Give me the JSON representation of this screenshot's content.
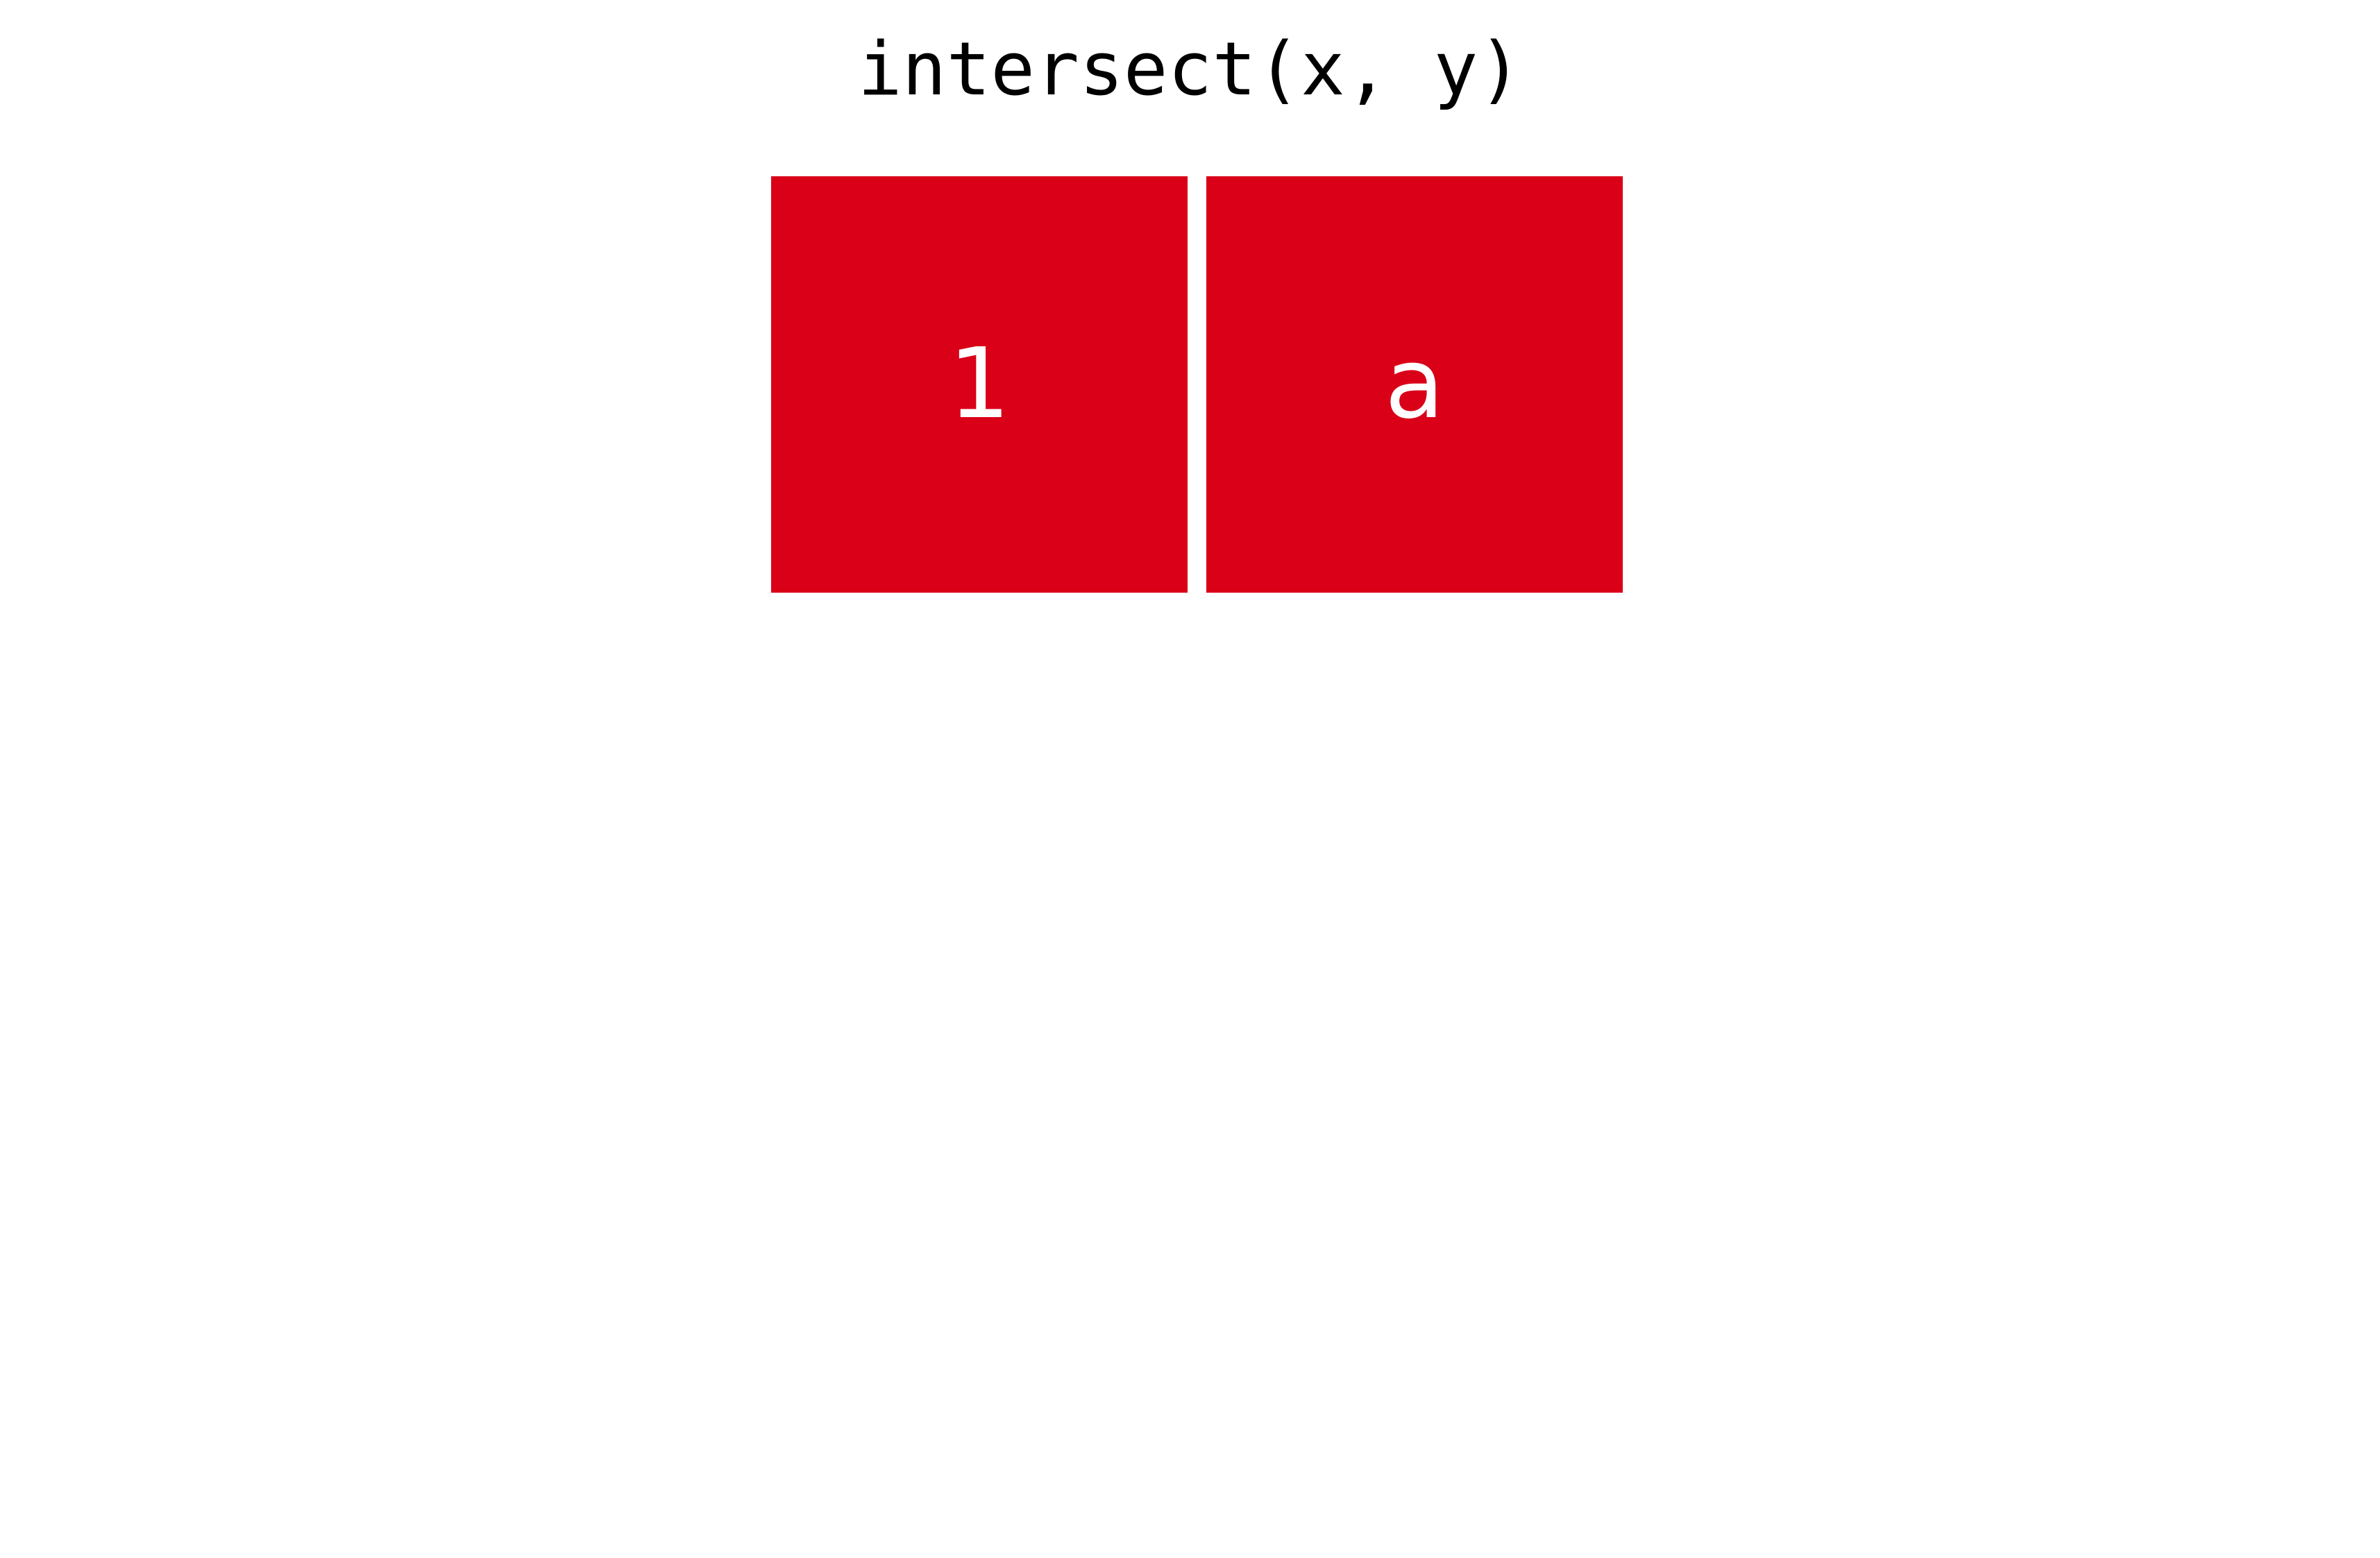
{
  "title": "intersect(x, y)",
  "colors": {
    "cell_fill": "#d90018",
    "cell_text": "#ffffff",
    "background": "#ffffff"
  },
  "result": {
    "cells": [
      {
        "label": "1"
      },
      {
        "label": "a"
      }
    ]
  }
}
